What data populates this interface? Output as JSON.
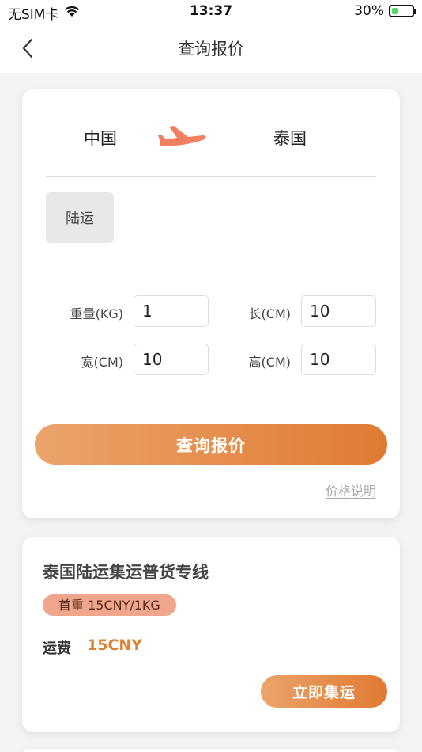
{
  "status_bar": {
    "carrier": "无SIM卡",
    "time": "13:37",
    "battery_percent": "30%",
    "battery_level": 0.3
  },
  "nav": {
    "title": "查询报价"
  },
  "route": {
    "origin": "中国",
    "destination": "泰国",
    "plane_color": "#f08060"
  },
  "transport_mode": {
    "label": "陆运"
  },
  "fields": {
    "weight": {
      "label": "重量(KG)",
      "value": "1"
    },
    "length": {
      "label": "长(CM)",
      "value": "10"
    },
    "width": {
      "label": "宽(CM)",
      "value": "10"
    },
    "height": {
      "label": "高(CM)",
      "value": "10"
    }
  },
  "actions": {
    "query_label": "查询报价",
    "price_note_label": "价格说明"
  },
  "result": {
    "title": "泰国陆运集运普货专线",
    "badge": "首重 15CNY/1KG",
    "fee_label": "运费",
    "fee_value": "15CNY",
    "ship_label": "立即集运"
  },
  "colors": {
    "accent_start": "#eba46b",
    "accent_end": "#e07a32",
    "fee": "#e08030",
    "badge": "#f0a68c"
  }
}
